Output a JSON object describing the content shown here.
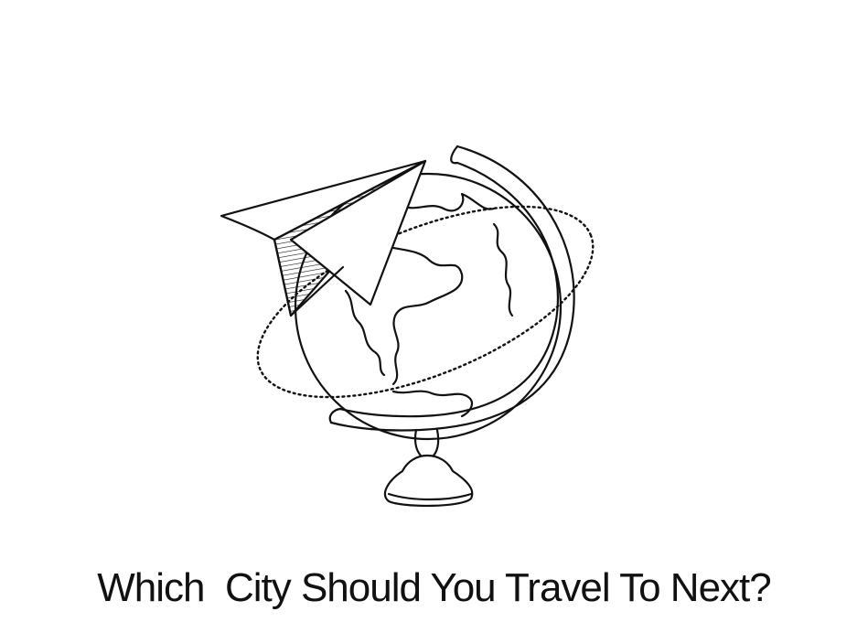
{
  "caption": "Which  City Should You Travel To Next?",
  "illustration": {
    "subject": "globe-with-paper-plane",
    "stroke_color": "#111111",
    "background_color": "#ffffff"
  }
}
